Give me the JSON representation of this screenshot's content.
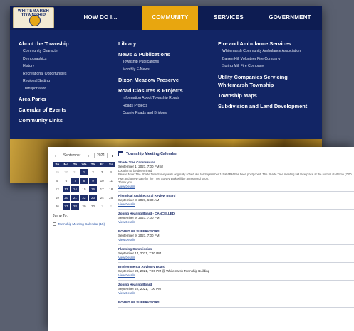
{
  "nav": {
    "logo_text": "WHITEMARSH TOWNSHIP",
    "items": [
      "HOW DO I...",
      "COMMUNITY",
      "SERVICES",
      "GOVERNMENT"
    ],
    "active": "COMMUNITY",
    "active_color": "#e8a60f"
  },
  "menu": {
    "col1": {
      "about": "About the Township",
      "about_sub": [
        "Community Character",
        "Demographics",
        "History",
        "Recreational Opportunities",
        "Regional Setting",
        "Transportation"
      ],
      "area_parks": "Area Parks",
      "calendar": "Calendar of Events",
      "links": "Community Links"
    },
    "col2": {
      "library": "Library",
      "news": "News & Publications",
      "news_sub": [
        "Township Publications",
        "Monthly E-News"
      ],
      "dixon": "Dixon Meadow Preserve",
      "road": "Road Closures & Projects",
      "road_sub": [
        "Information About Township Roads",
        "Roads Projects",
        "County Roads and Bridges"
      ]
    },
    "col3": {
      "fire": "Fire and Ambulance Services",
      "fire_sub": [
        "Whitemarsh Community Ambulance Association",
        "Barren Hill Volunteer Fire Company",
        "Spring Mill Fire Company"
      ],
      "utility": "Utility Companies Servicing Whitemarsh Township",
      "maps": "Township Maps",
      "subdivision": "Subdivision and Land Development"
    }
  },
  "calendar": {
    "month": "September",
    "year": "2021",
    "prev_icon": "chevron-left-icon",
    "next_icon": "chevron-right-icon",
    "day_headers": [
      "Su",
      "Mo",
      "Tu",
      "We",
      "Th",
      "Fr",
      "Sa"
    ],
    "weeks": [
      [
        {
          "d": "29",
          "o": true
        },
        {
          "d": "30",
          "o": true
        },
        {
          "d": "31",
          "o": true
        },
        {
          "d": "1",
          "e": true
        },
        {
          "d": "2"
        },
        {
          "d": "3"
        },
        {
          "d": "4"
        }
      ],
      [
        {
          "d": "5"
        },
        {
          "d": "6"
        },
        {
          "d": "7",
          "e": true
        },
        {
          "d": "8",
          "e": true
        },
        {
          "d": "9",
          "e": true
        },
        {
          "d": "10"
        },
        {
          "d": "11"
        }
      ],
      [
        {
          "d": "12"
        },
        {
          "d": "13",
          "e": true
        },
        {
          "d": "14",
          "e": true
        },
        {
          "d": "15"
        },
        {
          "d": "16",
          "e": true
        },
        {
          "d": "17"
        },
        {
          "d": "18"
        }
      ],
      [
        {
          "d": "19"
        },
        {
          "d": "20",
          "e": true
        },
        {
          "d": "21",
          "e": true
        },
        {
          "d": "22",
          "e": true
        },
        {
          "d": "23",
          "e": true
        },
        {
          "d": "24"
        },
        {
          "d": "25"
        }
      ],
      [
        {
          "d": "26"
        },
        {
          "d": "27",
          "e": true
        },
        {
          "d": "28",
          "e": true
        },
        {
          "d": "29"
        },
        {
          "d": "30"
        },
        {
          "d": "1",
          "o": true
        },
        {
          "d": "2",
          "o": true
        }
      ]
    ],
    "jump_label": "Jump To:",
    "jump_link": "Township Meeting Calendar (15)"
  },
  "events": {
    "header": "Township Meeting Calendar",
    "view_details": "View Details",
    "items": [
      {
        "title": "Shade Tree Commission",
        "date": "September 1, 2021, 7:00 PM @",
        "extra": [
          "Location to be determined",
          "Please Note: The Shade Tree Survey walk originally scheduled for September 1st at 6PM has been postponed. The Shade Tree meeting will take place at the normal start time (7:00 PM) and a new date for the Tree Survey walk will be announced soon.",
          "Thank you."
        ]
      },
      {
        "title": "Historical Architectural Review Board",
        "date": "September 8, 2021, 6:30 AM",
        "extra": []
      },
      {
        "title": "Zoning Hearing Board - CANCELLED",
        "date": "September 9, 2021, 7:00 PM",
        "extra": []
      },
      {
        "title": "BOARD OF SUPERVISORS",
        "date": "September 9, 2021, 7:00 PM",
        "extra": []
      },
      {
        "title": "Planning Commission",
        "date": "September 14, 2021, 7:30 PM",
        "extra": []
      },
      {
        "title": "Environmental Advisory Board",
        "date": "September 20, 2021, 7:00 PM @ Whitemarsh Township Building",
        "extra": []
      },
      {
        "title": "Zoning Hearing Board",
        "date": "September 22, 2021, 7:00 PM",
        "extra": []
      },
      {
        "title": "BOARD OF SUPERVISORS",
        "date": "",
        "extra": []
      }
    ]
  }
}
